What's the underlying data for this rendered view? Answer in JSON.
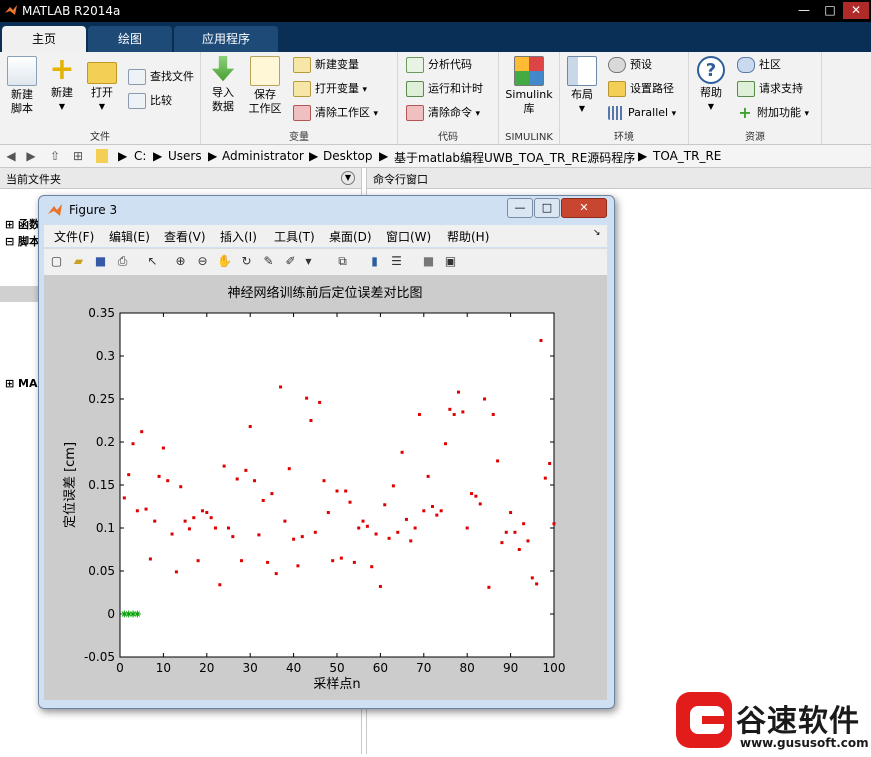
{
  "app": {
    "title": "MATLAB R2014a",
    "window_controls": [
      "—",
      "□",
      "✕"
    ]
  },
  "tabs": [
    {
      "label": "主页",
      "active": true
    },
    {
      "label": "绘图",
      "active": false
    },
    {
      "label": "应用程序",
      "active": false
    }
  ],
  "ribbon": {
    "file": {
      "group_label": "文件",
      "new_script": "新建\n脚本",
      "new": "新建",
      "open": "打开",
      "find_files": "查找文件",
      "compare": "比较"
    },
    "variable": {
      "group_label": "变量",
      "import_data": "导入\n数据",
      "save_workspace": "保存\n工作区",
      "new_variable": "新建变量",
      "open_variable": "打开变量",
      "clear_workspace": "清除工作区"
    },
    "code": {
      "group_label": "代码",
      "analyze_code": "分析代码",
      "run_and_time": "运行和计时",
      "clear_commands": "清除命令"
    },
    "simulink": {
      "group_label": "SIMULINK",
      "library": "Simulink\n库"
    },
    "environment": {
      "group_label": "环境",
      "layout": "布局",
      "preferences": "预设",
      "set_path": "设置路径",
      "parallel": "Parallel"
    },
    "resources": {
      "group_label": "资源",
      "help": "帮助",
      "community": "社区",
      "request_support": "请求支持",
      "add_ons": "附加功能"
    }
  },
  "address_bar": {
    "path": [
      "C:",
      "Users",
      "Administrator",
      "Desktop",
      "基于matlab编程UWB_TOA_TR_RE源码程序",
      "TOA_TR_RE"
    ]
  },
  "left_panel": {
    "title": "当前文件夹",
    "items": [
      "函数",
      "脚本",
      "MA"
    ]
  },
  "command_panel": {
    "title": "命令行窗口"
  },
  "figure": {
    "title": "Figure 3",
    "menu": [
      "文件(F)",
      "编辑(E)",
      "查看(V)",
      "插入(I)",
      "工具(T)",
      "桌面(D)",
      "窗口(W)",
      "帮助(H)"
    ]
  },
  "chart_data": {
    "type": "scatter",
    "title": "神经网络训练前后定位误差对比图",
    "xlabel": "采样点n",
    "ylabel": "定位误差 [cm]",
    "xlim": [
      0,
      100
    ],
    "ylim": [
      -0.05,
      0.35
    ],
    "xticks": [
      0,
      10,
      20,
      30,
      40,
      50,
      60,
      70,
      80,
      90,
      100
    ],
    "yticks": [
      -0.05,
      0,
      0.05,
      0.1,
      0.15,
      0.2,
      0.25,
      0.3,
      0.35
    ],
    "grid": false,
    "series": [
      {
        "marker": "dot",
        "color": "#e00000",
        "x": [
          1,
          2,
          3,
          4,
          5,
          6,
          7,
          8,
          9,
          10,
          11,
          12,
          13,
          14,
          15,
          16,
          17,
          18,
          19,
          20,
          21,
          22,
          23,
          24,
          25,
          26,
          27,
          28,
          29,
          30,
          31,
          32,
          33,
          34,
          35,
          36,
          37,
          38,
          39,
          40,
          41,
          42,
          43,
          44,
          45,
          46,
          47,
          48,
          49,
          50,
          51,
          52,
          53,
          54,
          55,
          56,
          57,
          58,
          59,
          60,
          61,
          62,
          63,
          64,
          65,
          66,
          67,
          68,
          69,
          70,
          71,
          72,
          73,
          74,
          75,
          76,
          77,
          78,
          79,
          80,
          81,
          82,
          83,
          84,
          85,
          86,
          87,
          88,
          89,
          90,
          91,
          92,
          93,
          94,
          95,
          96,
          97,
          98,
          99,
          100
        ],
        "y": [
          0.135,
          0.162,
          0.198,
          0.12,
          0.212,
          0.122,
          0.064,
          0.108,
          0.16,
          0.193,
          0.155,
          0.093,
          0.049,
          0.148,
          0.108,
          0.099,
          0.112,
          0.062,
          0.12,
          0.118,
          0.112,
          0.1,
          0.034,
          0.172,
          0.1,
          0.09,
          0.157,
          0.062,
          0.167,
          0.218,
          0.155,
          0.092,
          0.132,
          0.06,
          0.14,
          0.047,
          0.264,
          0.108,
          0.169,
          0.087,
          0.056,
          0.09,
          0.251,
          0.225,
          0.095,
          0.246,
          0.155,
          0.118,
          0.062,
          0.143,
          0.065,
          0.143,
          0.13,
          0.06,
          0.1,
          0.108,
          0.102,
          0.055,
          0.093,
          0.032,
          0.127,
          0.088,
          0.149,
          0.095,
          0.188,
          0.11,
          0.085,
          0.1,
          0.232,
          0.12,
          0.16,
          0.125,
          0.115,
          0.12,
          0.198,
          0.238,
          0.232,
          0.258,
          0.235,
          0.1,
          0.14,
          0.137,
          0.128,
          0.25,
          0.031,
          0.232,
          0.178,
          0.083,
          0.095,
          0.118,
          0.095,
          0.075,
          0.105,
          0.085,
          0.042,
          0.035,
          0.318,
          0.158,
          0.175,
          0.105
        ]
      },
      {
        "marker": "star",
        "color": "#00a000",
        "x": [
          1,
          2,
          3,
          4
        ],
        "y": [
          0,
          0,
          0,
          0
        ]
      }
    ]
  },
  "watermark": {
    "brand": "谷速软件",
    "url": "www.gususoft.com",
    "colors": {
      "red": "#e21b1b",
      "dark": "#1a1a1a"
    }
  }
}
